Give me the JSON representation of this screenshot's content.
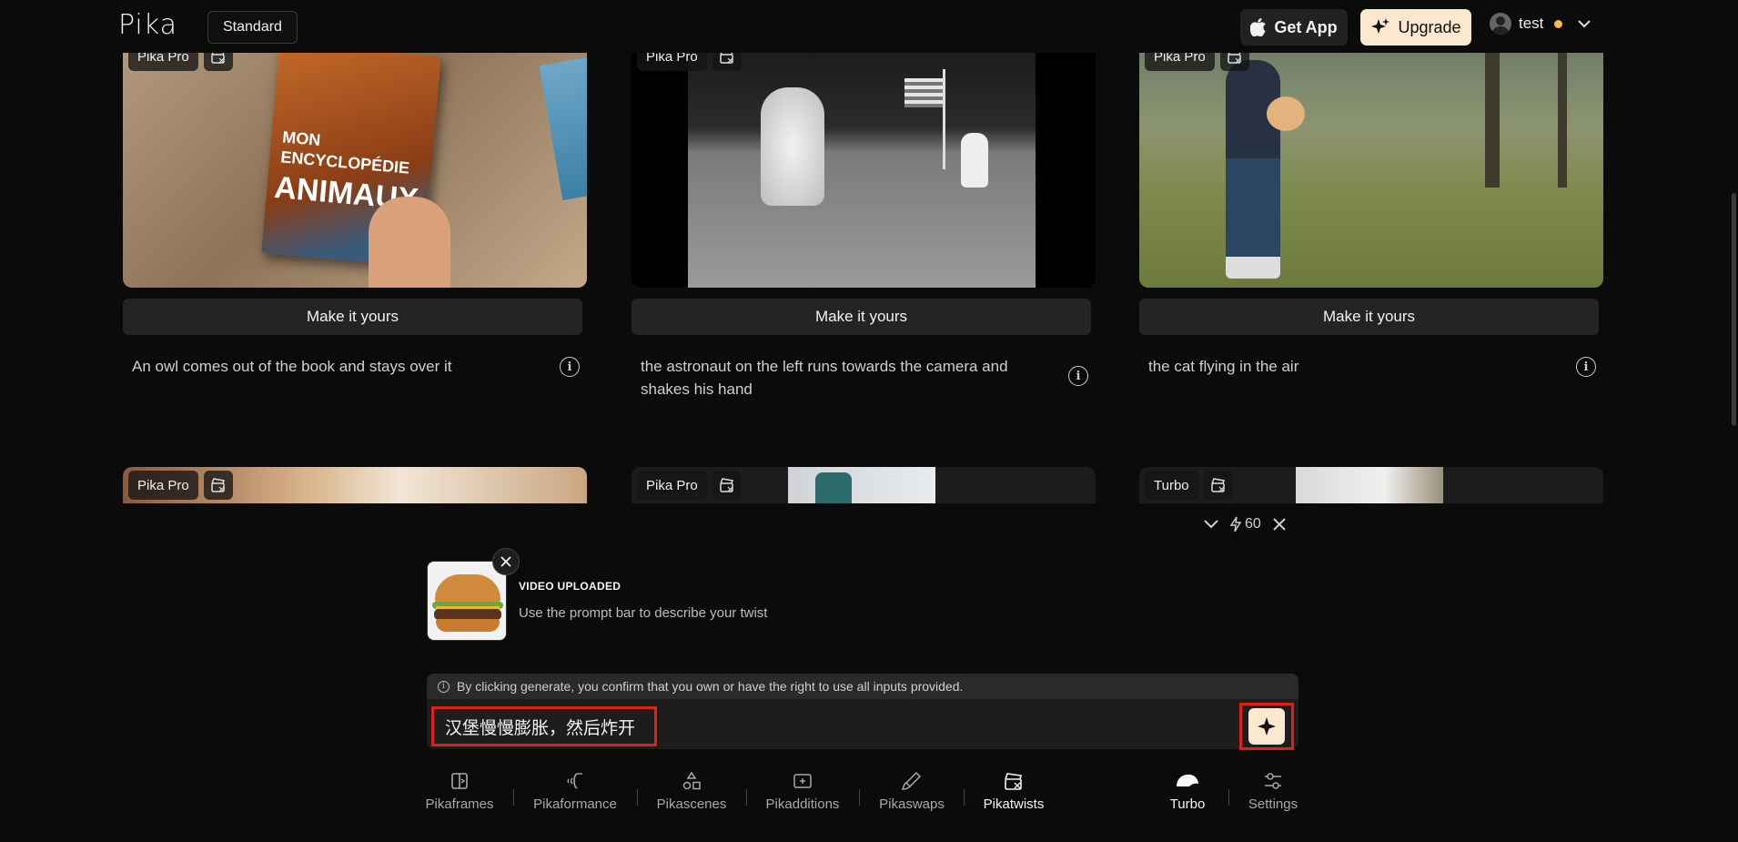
{
  "header": {
    "logo": "Pika",
    "plan": "Standard",
    "get_app_label": "Get App",
    "upgrade_label": "Upgrade",
    "username": "test"
  },
  "feed": {
    "cards": [
      {
        "tags": [
          "Pika Pro"
        ],
        "button": "Make it yours",
        "caption": "An owl comes out of the book and stays over it",
        "book_title_1": "MON",
        "book_title_2": "ENCYCLOPÉDIE",
        "book_title_3": "ANIMAUX"
      },
      {
        "tags": [
          "Pika Pro"
        ],
        "button": "Make it yours",
        "caption": "the astronaut on the left runs towards the camera and shakes his hand"
      },
      {
        "tags": [
          "Pika Pro"
        ],
        "button": "Make it yours",
        "caption": "the cat flying in the air"
      }
    ],
    "row2_tags": [
      "Pika Pro",
      "Pika Pro",
      "Turbo"
    ]
  },
  "panel": {
    "credits": "60",
    "upload": {
      "title": "VIDEO UPLOADED",
      "subtitle": "Use the prompt bar to describe your twist"
    },
    "disclaimer": "By clicking generate, you confirm that you own or have the right to use all inputs provided.",
    "prompt_value": "汉堡慢慢膨胀，然后炸开"
  },
  "toolbar": {
    "items": [
      {
        "label": "Pikaframes",
        "icon": "frames-icon",
        "active": false
      },
      {
        "label": "Pikaformance",
        "icon": "performance-icon",
        "active": false
      },
      {
        "label": "Pikascenes",
        "icon": "shapes-icon",
        "active": false
      },
      {
        "label": "Pikadditions",
        "icon": "additions-icon",
        "active": false
      },
      {
        "label": "Pikaswaps",
        "icon": "brush-icon",
        "active": false
      },
      {
        "label": "Pikatwists",
        "icon": "twist-icon",
        "active": true
      }
    ],
    "right": [
      {
        "label": "Turbo",
        "icon": "turbo-icon",
        "active": true
      },
      {
        "label": "Settings",
        "icon": "sliders-icon",
        "active": false
      }
    ]
  },
  "colors": {
    "accent": "#fbe8cf",
    "highlight": "#e0201a",
    "background": "#0b0b0b"
  }
}
